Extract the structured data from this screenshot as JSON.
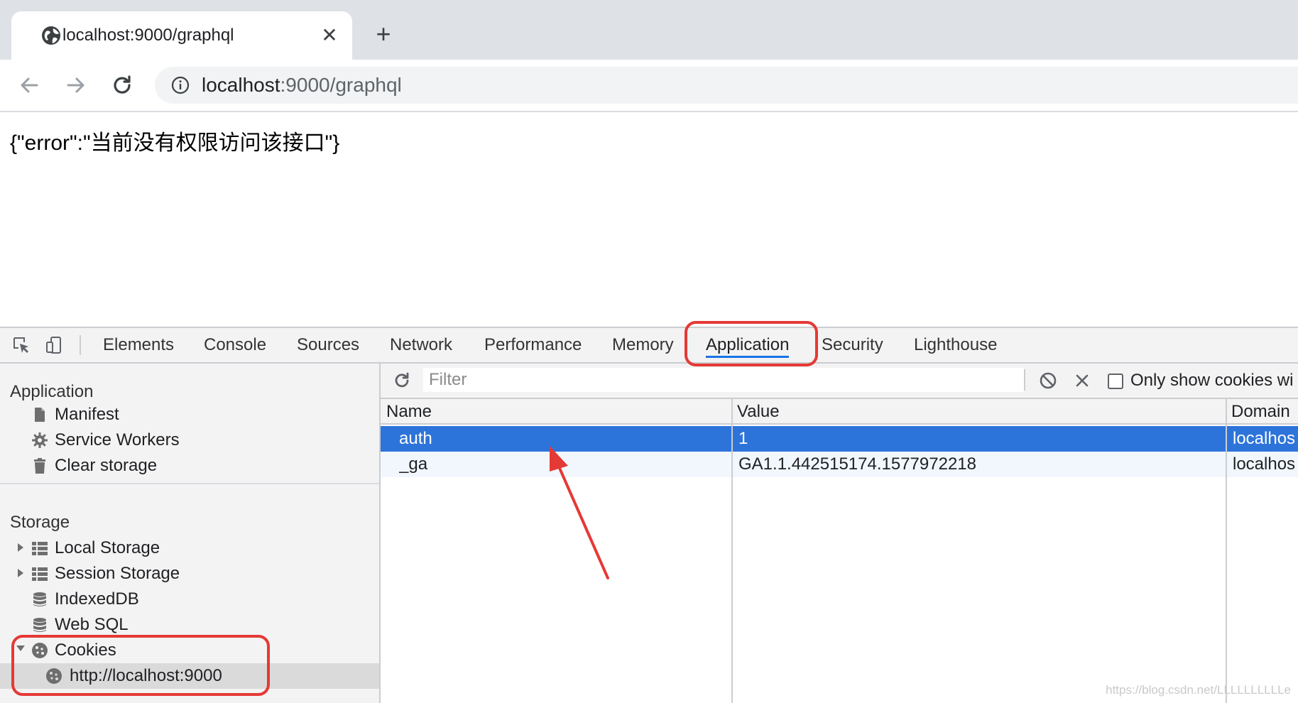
{
  "browser": {
    "tab": {
      "title": "localhost:9000/graphql",
      "close_glyph": "✕",
      "favicon": "globe-icon"
    },
    "new_tab_glyph": "+",
    "toolbar": {
      "back_icon": "arrow-left-icon",
      "forward_icon": "arrow-right-icon",
      "reload_icon": "reload-icon",
      "info_icon": "info-icon",
      "url_host": "localhost",
      "url_rest": ":9000/graphql"
    }
  },
  "page": {
    "body_text": "{\"error\":\"当前没有权限访问该接口\"}"
  },
  "devtools": {
    "tabs": [
      {
        "label": "Elements",
        "active": false
      },
      {
        "label": "Console",
        "active": false
      },
      {
        "label": "Sources",
        "active": false
      },
      {
        "label": "Network",
        "active": false
      },
      {
        "label": "Performance",
        "active": false
      },
      {
        "label": "Memory",
        "active": false
      },
      {
        "label": "Application",
        "active": true
      },
      {
        "label": "Security",
        "active": false
      },
      {
        "label": "Lighthouse",
        "active": false
      }
    ],
    "sidebar": {
      "application_title": "Application",
      "application_items": [
        "Manifest",
        "Service Workers",
        "Clear storage"
      ],
      "storage_title": "Storage",
      "storage_items": [
        "Local Storage",
        "Session Storage",
        "IndexedDB",
        "Web SQL",
        "Cookies"
      ],
      "cookie_origin": "http://localhost:9000"
    },
    "filterbar": {
      "placeholder": "Filter",
      "only_show_label": "Only show cookies wi"
    },
    "table": {
      "columns": [
        "Name",
        "Value",
        "Domain"
      ],
      "rows": [
        {
          "name": "auth",
          "value": "1",
          "domain": "localhos",
          "selected": true
        },
        {
          "name": "_ga",
          "value": "GA1.1.442515174.1577972218",
          "domain": "localhos",
          "selected": false
        }
      ]
    }
  },
  "colors": {
    "selection": "#2d74da",
    "annotation": "#e53935",
    "active_tab_underline": "#1a73e8"
  },
  "watermark": "https://blog.csdn.net/LLLLLLLLLLe"
}
